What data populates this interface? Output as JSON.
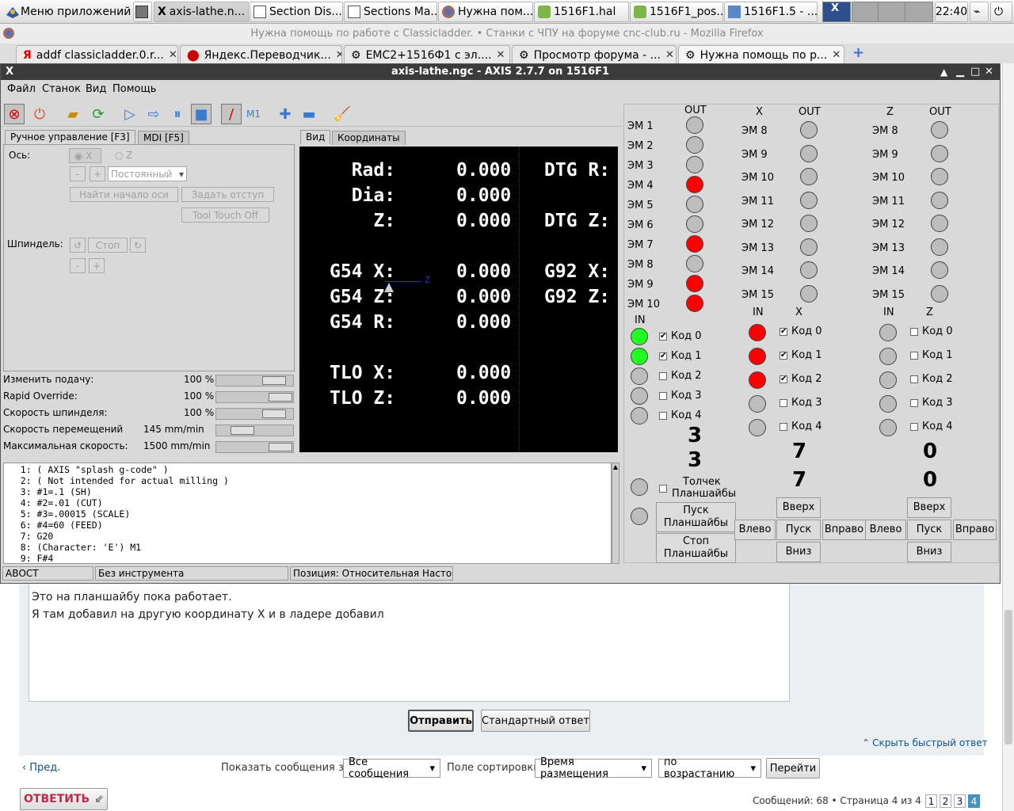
{
  "taskbar": {
    "menu_label": "Меню приложений",
    "items": [
      "axis-lathe.n...",
      "Section Dis...",
      "Sections Ma...",
      "Нужна пом...",
      "1516F1.hal",
      "1516F1_pos...",
      "1516F1.5 - ..."
    ],
    "clock": "22:40"
  },
  "firefox": {
    "title": "Нужна помощь по работе с Classicladder. • Станки с ЧПУ на форуме cnc-club.ru - Mozilla Firefox",
    "tabs": [
      "addf classicladder.0.r...",
      "Яндекс.Переводчик...",
      "EMC2+1516Ф1 с эл....",
      "Просмотр форума - ...",
      "Нужна помощь по р..."
    ],
    "close_label": "✕",
    "new_tab_label": "+"
  },
  "page": {
    "reply_lines": [
      "Это на планшайбу пока работает.",
      "Я там добавил  на другую координату X и в ладере добавил"
    ],
    "submit_label": "Отправить",
    "standard_label": "Стандартный ответ",
    "hide_quick": "Скрыть быстрый ответ",
    "prev": "Пред.",
    "show_msgs_label": "Показать сообщения за:",
    "show_msgs_value": "Все сообщения",
    "sort_label": "Поле сортировки",
    "sort_value": "Время размещения",
    "order_value": "по возрастанию",
    "go_label": "Перейти",
    "reply_button": "ОТВЕТИТЬ",
    "pagination_text": "Сообщений: 68 • Страница 4 из 4 •",
    "pages": [
      "1",
      "2",
      "3",
      "4"
    ]
  },
  "axis": {
    "title": "axis-lathe.ngc - AXIS 2.7.7 on 1516F1",
    "menu": [
      "Файл",
      "Станок",
      "Вид",
      "Помощь"
    ],
    "tabs_left": [
      "Ручное управление [F3]",
      "MDI [F5]"
    ],
    "tabs_right": [
      "Вид",
      "Координаты"
    ],
    "axis_label": "Ось:",
    "axis_x": "X",
    "axis_z": "Z",
    "jog_minus": "-",
    "jog_plus": "+",
    "jog_mode": "Постоянный",
    "home_button": "Найти начало оси",
    "offset_button": "Задать отступ",
    "touch_button": "Tool Touch Off",
    "spindle_label": "Шпиндель:",
    "stop_label": "Стоп",
    "overrides": [
      {
        "label": "Изменить подачу:",
        "value": "100 %"
      },
      {
        "label": "Rapid Override:",
        "value": "100 %"
      },
      {
        "label": "Скорость шпинделя:",
        "value": "100 %"
      },
      {
        "label": "Скорость перемещений",
        "value": "145 mm/min"
      },
      {
        "label": "Максимальная скорость:",
        "value": "1500 mm/min"
      }
    ],
    "dro": [
      {
        "label": "  Rad:",
        "value": "0.000",
        "extra": "DTG R:"
      },
      {
        "label": "  Dia:",
        "value": "0.000",
        "extra": ""
      },
      {
        "label": "    Z:",
        "value": "0.000",
        "extra": "DTG Z:"
      },
      {
        "label": "",
        "value": "",
        "extra": ""
      },
      {
        "label": "G54 X:",
        "value": "0.000",
        "extra": "G92 X:"
      },
      {
        "label": "G54 Z:",
        "value": "0.000",
        "extra": "G92 Z:"
      },
      {
        "label": "G54 R:",
        "value": "0.000",
        "extra": ""
      },
      {
        "label": "",
        "value": "",
        "extra": ""
      },
      {
        "label": "TLO X:",
        "value": "0.000",
        "extra": ""
      },
      {
        "label": "TLO Z:",
        "value": "0.000",
        "extra": ""
      }
    ],
    "z_marker": "Z",
    "gcode": [
      "   1: ( AXIS \"splash g-code\" )",
      "   2: ( Not intended for actual milling )",
      "   3: #1=.1 (SH)",
      "   4: #2=.01 (CUT)",
      "   5: #3=.00015 (SCALE)",
      "   6: #4=60 (FEED)",
      "   7: G20",
      "   8: (Character: 'E') M1",
      "   9: F#4"
    ],
    "status": [
      "АВОСТ",
      "Без инструмента",
      "Позиция: Относительная Насто"
    ]
  },
  "hal": {
    "col1": {
      "out_header": "OUT",
      "em": [
        "ЭМ 1",
        "ЭМ 2",
        "ЭМ 3",
        "ЭМ 4",
        "ЭМ 5",
        "ЭМ 6",
        "ЭМ 7",
        "ЭМ 8",
        "ЭМ 9",
        "ЭМ 10"
      ],
      "states": [
        "off",
        "off",
        "off",
        "red",
        "off",
        "off",
        "red",
        "off",
        "red",
        "red"
      ],
      "in_header": "IN",
      "codes": [
        "Код 0",
        "Код 1",
        "Код 2",
        "Код 3",
        "Код 4"
      ],
      "code_checked": [
        true,
        true,
        false,
        false,
        false
      ],
      "in_states": [
        "green",
        "green",
        "off",
        "off",
        "off"
      ],
      "num1": "3",
      "num2": "3",
      "tolchek": "Толчек",
      "planshaiby": "Планшайбы",
      "start_btn": "Пуск Планшайбы",
      "stop_btn": "Стоп Планшайбы"
    },
    "colX": {
      "axis": "X",
      "out_header": "OUT",
      "em": [
        "ЭМ 8",
        "ЭМ 9",
        "ЭМ 10",
        "ЭМ 11",
        "ЭМ 12",
        "ЭМ 13",
        "ЭМ 14",
        "ЭМ 15"
      ],
      "in_header": "IN",
      "codes": [
        "Код 0",
        "Код 1",
        "Код 2",
        "Код 3",
        "Код 4"
      ],
      "code_checked": [
        true,
        true,
        true,
        false,
        false
      ],
      "in_states": [
        "red",
        "red",
        "red",
        "off",
        "off"
      ],
      "num1": "7",
      "num2": "7",
      "up": "Вверх",
      "left": "Влево",
      "start": "Пуск",
      "right": "Вправо",
      "down": "Вниз"
    },
    "colZ": {
      "axis": "Z",
      "out_header": "OUT",
      "em": [
        "ЭМ 8",
        "ЭМ 9",
        "ЭМ 10",
        "ЭМ 11",
        "ЭМ 12",
        "ЭМ 13",
        "ЭМ 14",
        "ЭМ 15"
      ],
      "in_header": "IN",
      "codes": [
        "Код 0",
        "Код 1",
        "Код 2",
        "Код 3",
        "Код 4"
      ],
      "code_checked": [
        false,
        false,
        false,
        false,
        false
      ],
      "in_states": [
        "off",
        "off",
        "off",
        "off",
        "off"
      ],
      "num1": "0",
      "num2": "0",
      "up": "Вверх",
      "left": "Влево",
      "start": "Пуск",
      "right": "Вправо",
      "down": "Вниз"
    }
  }
}
